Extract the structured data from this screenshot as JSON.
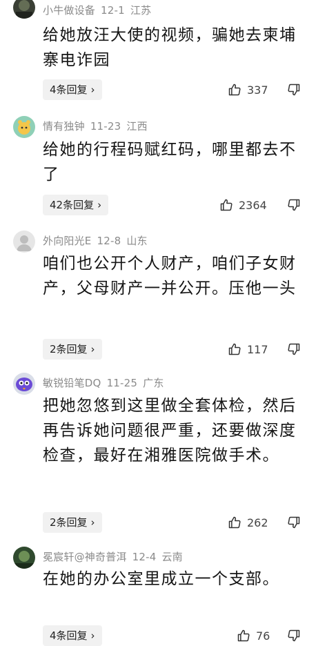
{
  "comments": [
    {
      "username": "小牛做设备",
      "date": "12-1",
      "location": "江苏",
      "text": "给她放汪大使的视频，骗她去柬埔寨电诈园",
      "replies": "4条回复",
      "likes": "337",
      "avatar_color": "#3a3f35"
    },
    {
      "username": "情有独钟",
      "date": "11-23",
      "location": "江西",
      "text": "给她的行程码赋红码，哪里都去不了",
      "replies": "42条回复",
      "likes": "2364",
      "avatar_color": "#8fd0b7"
    },
    {
      "username": "外向阳光E",
      "date": "12-8",
      "location": "山东",
      "text": "咱们也公开个人财产，咱们子女财产，父母财产一并公开。压他一头",
      "replies": "2条回复",
      "likes": "117",
      "avatar_color": "#e6e6e6"
    },
    {
      "username": "敏锐铅笔DQ",
      "date": "11-25",
      "location": "广东",
      "text": "把她忽悠到这里做全套体检，然后再告诉她问题很严重，还要做深度检查，最好在湘雅医院做手术。",
      "replies": "2条回复",
      "likes": "262",
      "avatar_color": "#6b4bd6"
    },
    {
      "username": "冕宸轩@神奇普洱",
      "date": "12-4",
      "location": "云南",
      "text": "在她的办公室里成立一个支部。",
      "replies": "4条回复",
      "likes": "76",
      "avatar_color": "#2f4a2e"
    }
  ],
  "icons": {
    "reply_chevron": "chevron-right-icon",
    "like": "thumbs-up-icon",
    "dislike": "thumbs-down-icon"
  }
}
